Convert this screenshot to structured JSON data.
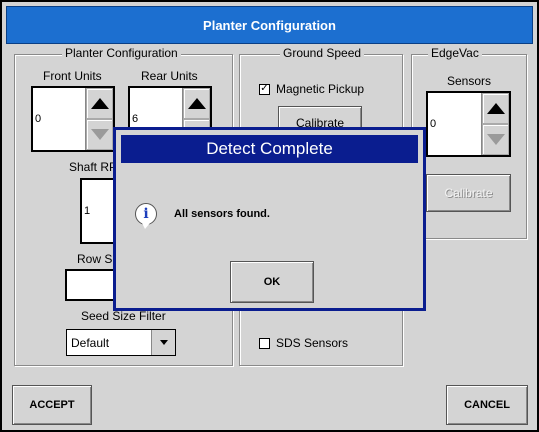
{
  "window": {
    "title": "Planter Configuration"
  },
  "planter": {
    "group_title": "Planter Configuration",
    "front_units_label": "Front Units",
    "front_units_value": "0",
    "rear_units_label": "Rear Units",
    "rear_units_value": "6",
    "shaft_rpm_label": "Shaft RP",
    "shaft_rpm_value": "1",
    "row_spacing_label": "Row Sp",
    "seed_size_filter_label": "Seed Size Filter",
    "seed_size_filter_value": "Default"
  },
  "ground_speed": {
    "group_title": "Ground Speed",
    "magnetic_pickup_label": "Magnetic Pickup",
    "magnetic_pickup_checked": true,
    "calibrate_label": "Calibrate",
    "sds_sensors_label": "SDS Sensors",
    "sds_sensors_checked": false
  },
  "edgevac": {
    "group_title": "EdgeVac",
    "sensors_label": "Sensors",
    "sensors_value": "0",
    "calibrate_label": "Calibrate"
  },
  "footer": {
    "accept_label": "ACCEPT",
    "cancel_label": "CANCEL"
  },
  "dialog": {
    "title": "Detect Complete",
    "icon": "info-icon",
    "icon_glyph": "i",
    "message": "All sensors found.",
    "ok_label": "OK"
  },
  "colors": {
    "titlebar": "#1c6fd0",
    "dialog_frame": "#0a1d8f",
    "window_bg": "#d4d4d4"
  }
}
